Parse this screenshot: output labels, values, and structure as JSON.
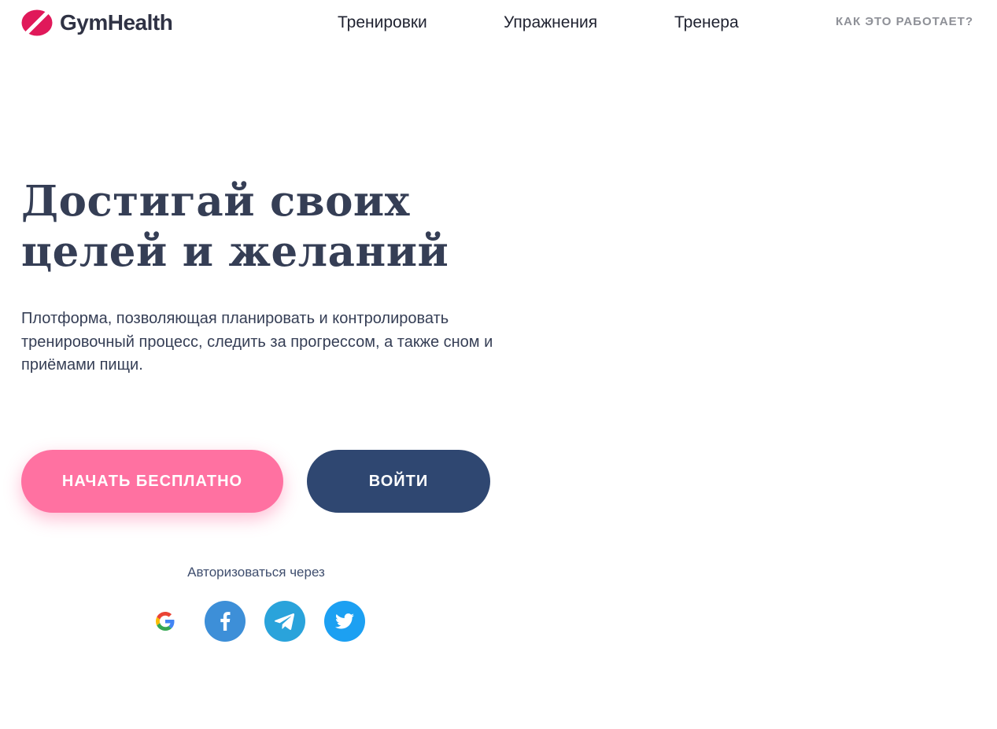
{
  "brand": {
    "name": "GymHealth",
    "accent_color": "#e0195a"
  },
  "nav": {
    "items": [
      {
        "label": "Тренировки"
      },
      {
        "label": "Упражнения"
      },
      {
        "label": "Тренера"
      }
    ],
    "how_it_works": "КАК ЭТО РАБОТАЕТ?"
  },
  "hero": {
    "title_line1": "Достигай своих",
    "title_line2": "целей и желаний",
    "description": "Плотформа, позволяющая планировать и контролировать тренировочный процесс, следить за прогрессом, а также сном и приёмами пищи.",
    "cta_start": "НАЧАТЬ БЕСПЛАТНО",
    "cta_login": "ВОЙТИ"
  },
  "auth": {
    "label": "Авторизоваться через",
    "providers": [
      {
        "icon": "google-icon",
        "color": "#4285f4"
      },
      {
        "icon": "facebook-icon",
        "color": "#3d8fd8"
      },
      {
        "icon": "telegram-icon",
        "color": "#2aa3db"
      },
      {
        "icon": "twitter-icon",
        "color": "#1ca0f2"
      }
    ]
  },
  "colors": {
    "primary_button": "#ff71a1",
    "secondary_button": "#2f4771",
    "heading": "#353e55"
  }
}
